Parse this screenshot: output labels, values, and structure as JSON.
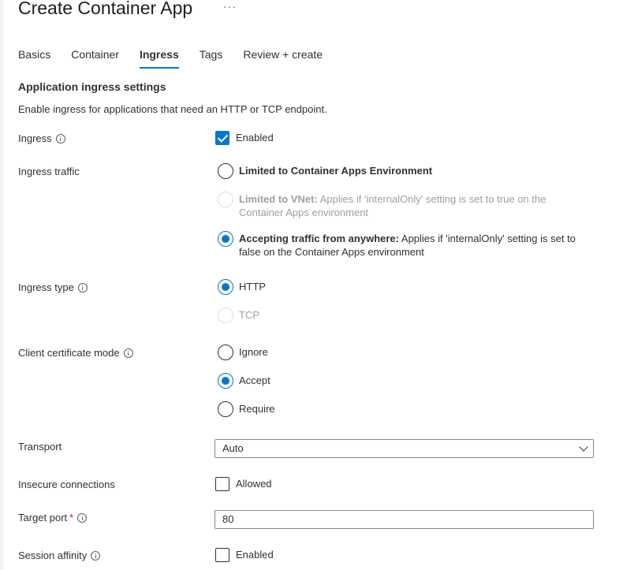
{
  "page": {
    "title": "Create Container App",
    "more_icon": "ellipsis-icon",
    "more_text": "···"
  },
  "tabs": [
    {
      "label": "Basics",
      "active": false
    },
    {
      "label": "Container",
      "active": false
    },
    {
      "label": "Ingress",
      "active": true
    },
    {
      "label": "Tags",
      "active": false
    },
    {
      "label": "Review + create",
      "active": false
    }
  ],
  "section": {
    "title": "Application ingress settings",
    "description": "Enable ingress for applications that need an HTTP or TCP endpoint."
  },
  "ingress": {
    "label": "Ingress",
    "checkbox_label": "Enabled",
    "checked": true
  },
  "ingress_traffic": {
    "label": "Ingress traffic",
    "options": [
      {
        "bold": "Limited to Container Apps Environment",
        "rest": "",
        "selected": false,
        "disabled": false
      },
      {
        "bold": "Limited to VNet:",
        "rest": " Applies if 'internalOnly' setting is set to true on the Container Apps environment",
        "selected": false,
        "disabled": true
      },
      {
        "bold": "Accepting traffic from anywhere:",
        "rest": " Applies if 'internalOnly' setting is set to false on the Container Apps environment",
        "selected": true,
        "disabled": false
      }
    ]
  },
  "ingress_type": {
    "label": "Ingress type",
    "options": [
      {
        "label": "HTTP",
        "selected": true,
        "disabled": false
      },
      {
        "label": "TCP",
        "selected": false,
        "disabled": true
      }
    ]
  },
  "client_cert": {
    "label": "Client certificate mode",
    "options": [
      {
        "label": "Ignore",
        "selected": false
      },
      {
        "label": "Accept",
        "selected": true
      },
      {
        "label": "Require",
        "selected": false
      }
    ]
  },
  "transport": {
    "label": "Transport",
    "value": "Auto"
  },
  "insecure": {
    "label": "Insecure connections",
    "checkbox_label": "Allowed",
    "checked": false
  },
  "target_port": {
    "label": "Target port",
    "required_mark": "*",
    "value": "80"
  },
  "session_affinity": {
    "label": "Session affinity",
    "checkbox_label": "Enabled",
    "checked": false
  },
  "colors": {
    "accent": "#0078d4",
    "text": "#323130",
    "disabled": "#a19f9d"
  }
}
